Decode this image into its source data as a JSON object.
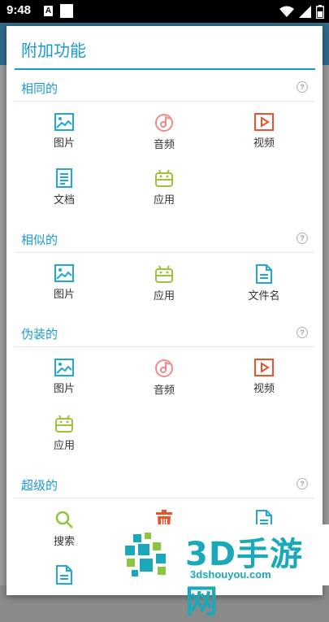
{
  "status_bar": {
    "time": "9:48",
    "notif_letter": "A"
  },
  "dialog": {
    "title": "附加功能"
  },
  "sections": [
    {
      "title": "相同的",
      "items": [
        {
          "label": "图片",
          "icon": "image-icon"
        },
        {
          "label": "音频",
          "icon": "audio-icon"
        },
        {
          "label": "视频",
          "icon": "video-icon"
        },
        {
          "label": "文档",
          "icon": "document-icon"
        },
        {
          "label": "应用",
          "icon": "android-icon"
        }
      ]
    },
    {
      "title": "相似的",
      "items": [
        {
          "label": "图片",
          "icon": "image-icon"
        },
        {
          "label": "应用",
          "icon": "android-icon"
        },
        {
          "label": "文件名",
          "icon": "file-icon"
        }
      ]
    },
    {
      "title": "伪装的",
      "items": [
        {
          "label": "图片",
          "icon": "image-icon"
        },
        {
          "label": "音频",
          "icon": "audio-icon"
        },
        {
          "label": "视频",
          "icon": "video-icon"
        },
        {
          "label": "应用",
          "icon": "android-icon"
        }
      ]
    },
    {
      "title": "超级的",
      "items": [
        {
          "label": "搜索",
          "icon": "search-icon"
        },
        {
          "label": "",
          "icon": "trash-icon"
        },
        {
          "label": "",
          "icon": "file-icon"
        },
        {
          "label": "",
          "icon": "file-icon"
        }
      ]
    }
  ],
  "help_symbol": "?",
  "banner": {
    "text": "3D手游网",
    "url": "3dshouyou.com"
  },
  "colors": {
    "accent": "#1a9bd0",
    "image": "#1fa7d6",
    "audio": "#ef8a8a",
    "video": "#e8552a",
    "android": "#9dc33b",
    "search": "#8cc63f",
    "trash": "#e8552a"
  }
}
